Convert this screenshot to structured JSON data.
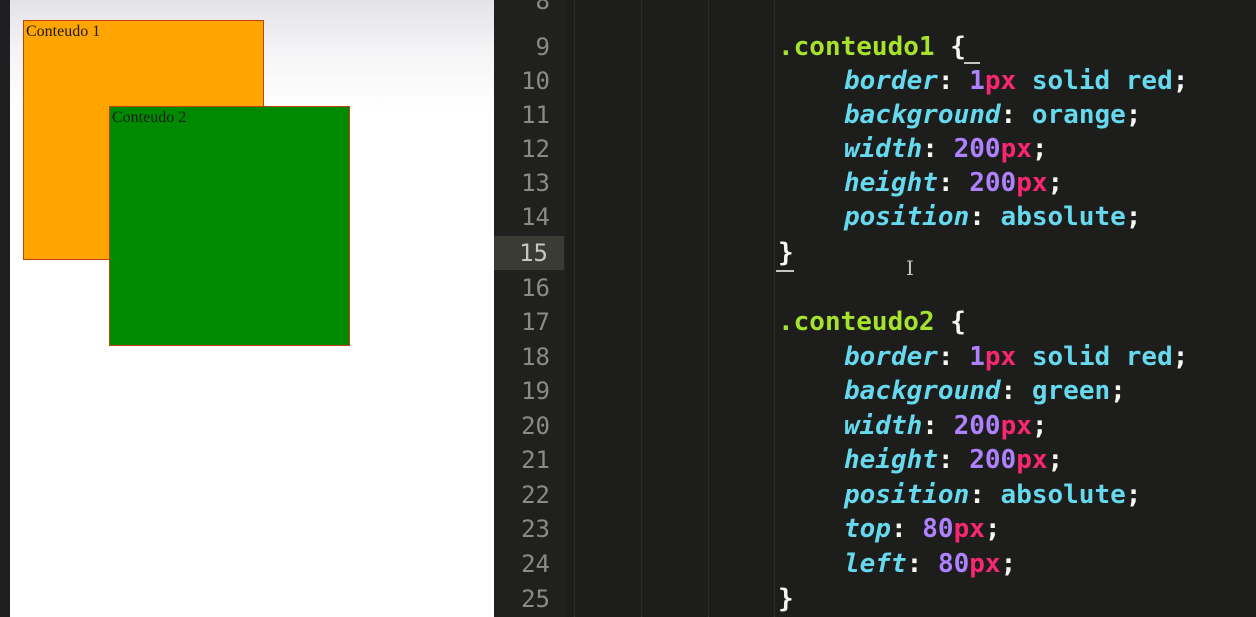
{
  "preview": {
    "box1": {
      "label": "Conteudo 1"
    },
    "box2": {
      "label": "Conteudo 2"
    }
  },
  "editor": {
    "line_numbers": [
      "8",
      "9",
      "10",
      "11",
      "12",
      "13",
      "14",
      "15",
      "16",
      "17",
      "18",
      "19",
      "20",
      "21",
      "22",
      "23",
      "24",
      "25"
    ],
    "current_line": "15",
    "code": {
      "l9_sel": ".conteudo1",
      "l9_brace": "{",
      "l10_prop": "border",
      "l10_colon": ":",
      "l10_num": "1",
      "l10_unit": "px",
      "l10_rest": " solid red",
      "l10_semi": ";",
      "l11_prop": "background",
      "l11_colon": ":",
      "l11_rest": " orange",
      "l11_semi": ";",
      "l12_prop": "width",
      "l12_colon": ":",
      "l12_num": "200",
      "l12_unit": "px",
      "l12_semi": ";",
      "l13_prop": "height",
      "l13_colon": ":",
      "l13_num": "200",
      "l13_unit": "px",
      "l13_semi": ";",
      "l14_prop": "position",
      "l14_colon": ":",
      "l14_rest": " absolute",
      "l14_semi": ";",
      "l15_brace": "}",
      "l17_sel": ".conteudo2",
      "l17_brace": "{",
      "l18_prop": "border",
      "l18_colon": ":",
      "l18_num": "1",
      "l18_unit": "px",
      "l18_rest": " solid red",
      "l18_semi": ";",
      "l19_prop": "background",
      "l19_colon": ":",
      "l19_rest": " green",
      "l19_semi": ";",
      "l20_prop": "width",
      "l20_colon": ":",
      "l20_num": "200",
      "l20_unit": "px",
      "l20_semi": ";",
      "l21_prop": "height",
      "l21_colon": ":",
      "l21_num": "200",
      "l21_unit": "px",
      "l21_semi": ";",
      "l22_prop": "position",
      "l22_colon": ":",
      "l22_rest": " absolute",
      "l22_semi": ";",
      "l23_prop": "top",
      "l23_colon": ":",
      "l23_num": "80",
      "l23_unit": "px",
      "l23_semi": ";",
      "l24_prop": "left",
      "l24_colon": ":",
      "l24_num": "80",
      "l24_unit": "px",
      "l24_semi": ";",
      "l25_brace": "}"
    },
    "cursor_glyph": "I"
  },
  "colors": {
    "box1_bg": "#ffa500",
    "box2_bg": "#008a00",
    "editor_bg": "#1d1e1c",
    "selector": "#a6e22e",
    "property": "#66d9ef",
    "number": "#ae81ff",
    "unit": "#f92672"
  }
}
